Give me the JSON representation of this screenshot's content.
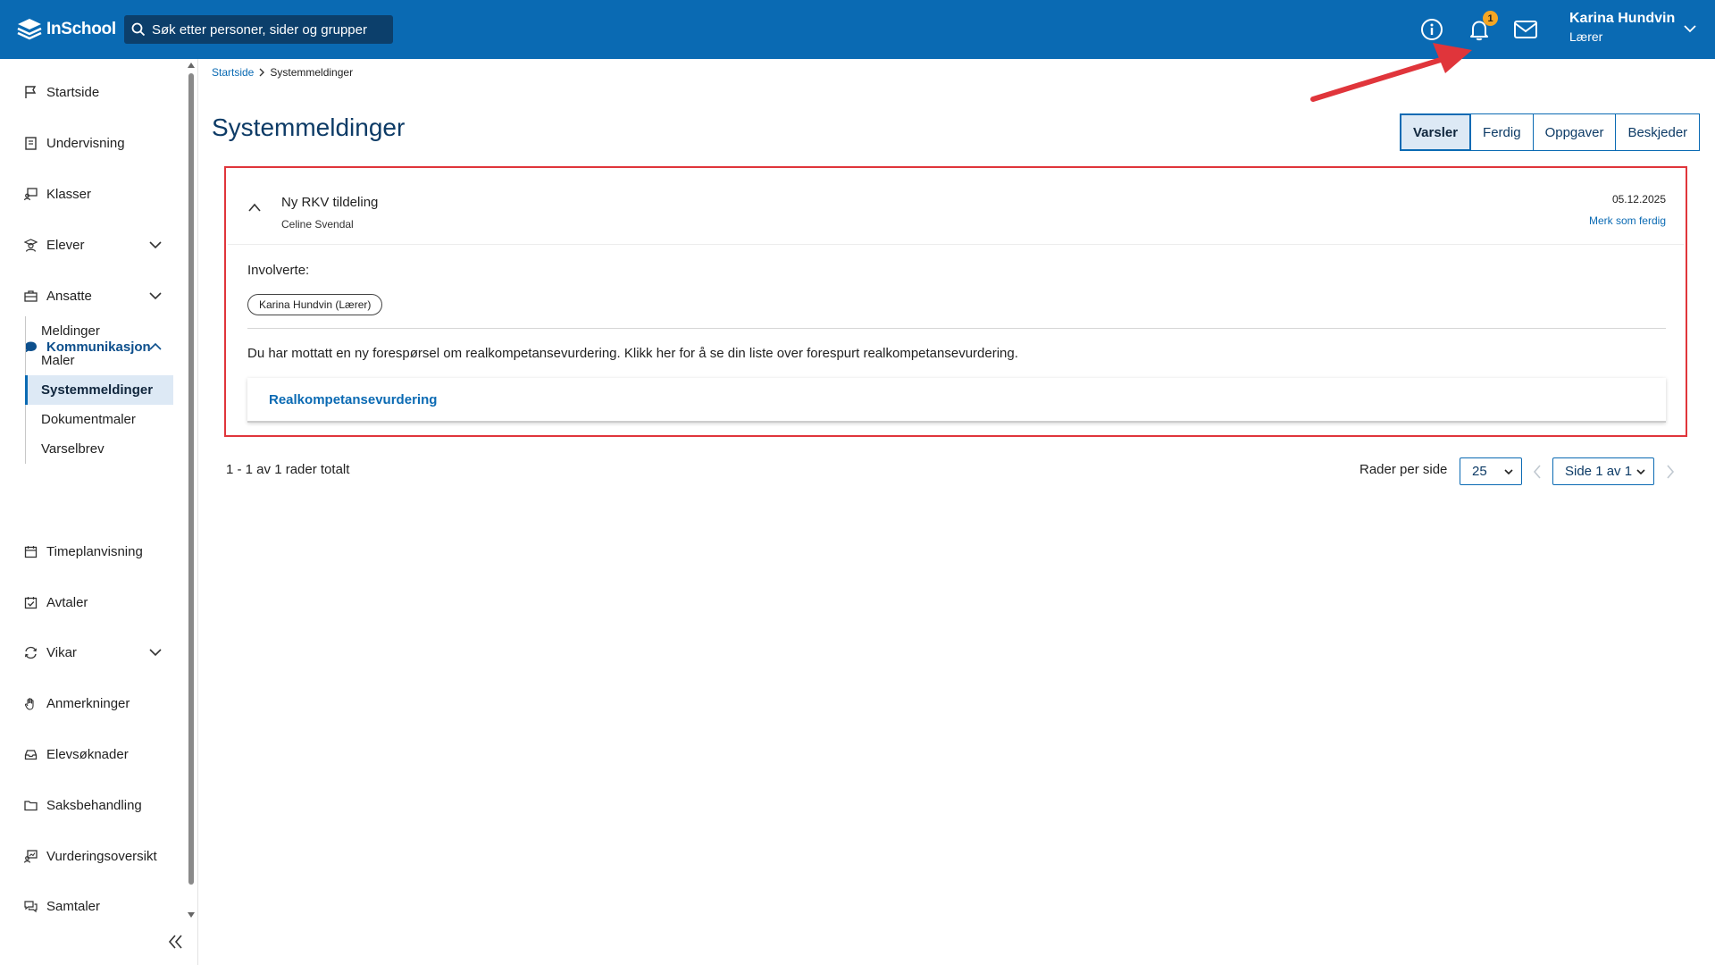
{
  "app": {
    "logo_text": "InSchool",
    "search_placeholder": "Søk etter personer, sider og grupper",
    "notification_count": "1",
    "user_name": "Karina Hundvin",
    "user_role": "Lærer"
  },
  "sidebar": {
    "items": [
      {
        "label": "Startside",
        "icon": "flag-icon"
      },
      {
        "label": "Undervisning",
        "icon": "book-icon"
      },
      {
        "label": "Klasser",
        "icon": "classroom-icon"
      },
      {
        "label": "Elever",
        "icon": "student-icon"
      },
      {
        "label": "Ansatte",
        "icon": "briefcase-icon"
      },
      {
        "label": "Kommunikasjon",
        "icon": "chat-icon"
      },
      {
        "label": "Timeplanvisning",
        "icon": "calendar-icon"
      },
      {
        "label": "Avtaler",
        "icon": "calendar-check-icon"
      },
      {
        "label": "Vikar",
        "icon": "swap-icon"
      },
      {
        "label": "Anmerkninger",
        "icon": "hand-icon"
      },
      {
        "label": "Elevsøknader",
        "icon": "inbox-icon"
      },
      {
        "label": "Saksbehandling",
        "icon": "folder-icon"
      },
      {
        "label": "Vurderingsoversikt",
        "icon": "chart-board-icon"
      },
      {
        "label": "Samtaler",
        "icon": "conversation-icon"
      }
    ],
    "sub_items": [
      "Meldinger",
      "Maler",
      "Systemmeldinger",
      "Dokumentmaler",
      "Varselbrev"
    ]
  },
  "breadcrumb": {
    "home": "Startside",
    "current": "Systemmeldinger"
  },
  "page": {
    "title": "Systemmeldinger"
  },
  "tabs": [
    "Varsler",
    "Ferdig",
    "Oppgaver",
    "Beskjeder"
  ],
  "notification": {
    "title": "Ny RKV tildeling",
    "sender": "Celine Svendal",
    "date": "05.12.2025",
    "mark_done": "Merk som ferdig",
    "involved_label": "Involverte:",
    "involved_chip": "Karina Hundvin (Lærer)",
    "message": "Du har mottatt en ny forespørsel om realkompetansevurdering. Klikk her for å se din liste over forespurt realkompetansevurdering.",
    "link_label": "Realkompetansevurdering"
  },
  "pagination": {
    "total_text": "1 - 1 av 1 rader totalt",
    "rows_per_page_label": "Rader per side",
    "rows_per_page_value": "25",
    "page_value": "Side 1 av 1"
  },
  "colors": {
    "brand": "#0a6ab3",
    "annotation": "#e0353b",
    "badge": "#f5a623"
  }
}
